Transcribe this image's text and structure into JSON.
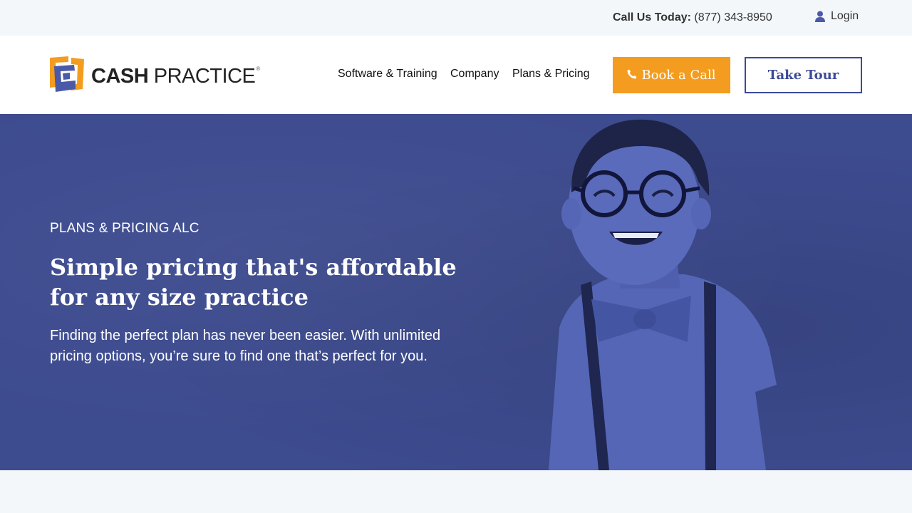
{
  "topbar": {
    "call_label": "Call Us Today:",
    "phone": "(877) 343-8950",
    "login_label": "Login"
  },
  "brand": {
    "name_bold": "CASH",
    "name_light": "PRACTICE",
    "registered": "®"
  },
  "nav": {
    "items": [
      {
        "label": "Software & Training"
      },
      {
        "label": "Company"
      },
      {
        "label": "Plans & Pricing"
      }
    ],
    "book_label": "Book a Call",
    "tour_label": "Take Tour"
  },
  "hero": {
    "eyebrow": "PLANS & PRICING ALC",
    "headline": "Simple pricing that's affordable for any size practice",
    "subtext": "Finding the perfect plan has never been easier. With unlimited pricing options, you’re sure to find one that’s perfect for you."
  },
  "colors": {
    "accent_orange": "#f39c1f",
    "brand_blue": "#3b4a98",
    "hero_bg": "#3d4b8f",
    "page_bg": "#f3f7fa"
  },
  "icons": {
    "login": "user-icon",
    "book": "phone-icon",
    "logo": "logo-mark-icon"
  }
}
